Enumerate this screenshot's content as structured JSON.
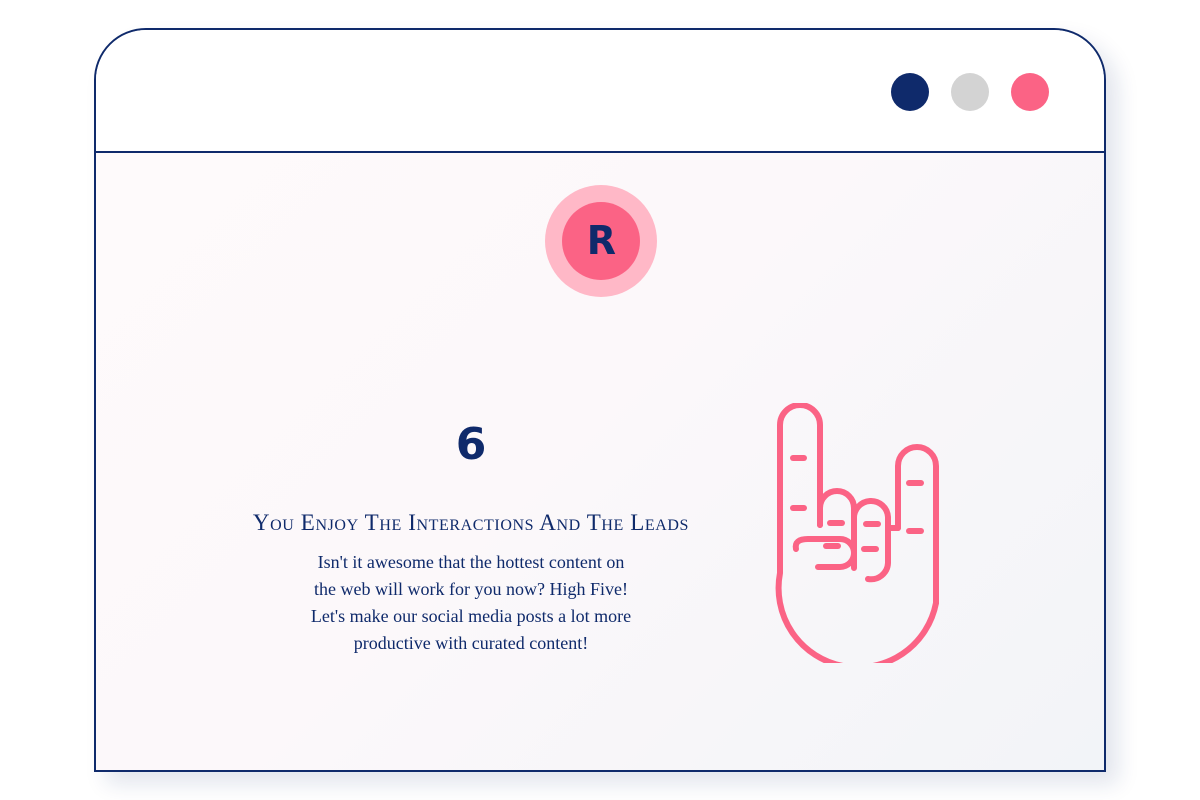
{
  "window": {
    "controls": [
      {
        "name": "window-dot-navy",
        "color": "#0f2a6b"
      },
      {
        "name": "window-dot-gray",
        "color": "#d3d3d3"
      },
      {
        "name": "window-dot-pink",
        "color": "#fb6385"
      }
    ]
  },
  "logo": {
    "letter": "R",
    "outer_color": "#ffb8c7",
    "inner_color": "#fb6385",
    "letter_color": "#0f2a6b"
  },
  "feature": {
    "number": "6",
    "title": "You Enjoy The Interactions And The Leads",
    "description_lines": [
      "Isn't it awesome that the hottest content on",
      "the web will work for you now? High Five!",
      "Let's make our social media posts a lot more",
      "productive with curated content!"
    ],
    "illustration_icon": "rock-hand-icon"
  },
  "colors": {
    "navy": "#0f2a6b",
    "pink": "#fb6385",
    "light_pink": "#ffb8c7",
    "gray": "#d3d3d3"
  }
}
